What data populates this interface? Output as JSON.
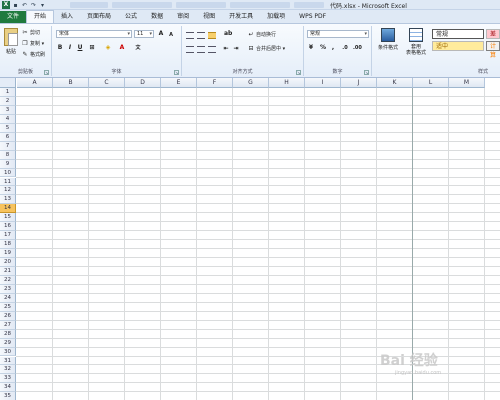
{
  "window": {
    "title": "代码.xlsx - Microsoft Excel"
  },
  "qat": {
    "app_icon": "X"
  },
  "tabs": [
    {
      "label": "文件"
    },
    {
      "label": "开始"
    },
    {
      "label": "插入"
    },
    {
      "label": "页面布局"
    },
    {
      "label": "公式"
    },
    {
      "label": "数据"
    },
    {
      "label": "审阅"
    },
    {
      "label": "视图"
    },
    {
      "label": "开发工具"
    },
    {
      "label": "加载项"
    },
    {
      "label": "WPS PDF"
    }
  ],
  "clipboard": {
    "paste": "粘贴",
    "cut": "剪切",
    "copy": "复制 ▾",
    "format_painter": "格式刷",
    "group": "剪贴板"
  },
  "font": {
    "name": "宋体",
    "size": "11",
    "grow": "A",
    "shrink": "A",
    "bold": "B",
    "italic": "I",
    "underline": "U",
    "wen": "文",
    "group": "字体"
  },
  "alignment": {
    "wrap": "自动换行",
    "merge": "合并后居中 ▾",
    "group": "对齐方式"
  },
  "number": {
    "format": "常规",
    "percent": "%",
    "comma": ",",
    "group": "数字"
  },
  "styles": {
    "conditional": "条件格式",
    "table": "套用\n表格格式",
    "normal": "常规",
    "bad": "差",
    "neutral": "适中",
    "calc": "计算",
    "group": "样式"
  },
  "columns": [
    "A",
    "B",
    "C",
    "D",
    "E",
    "F",
    "G",
    "H",
    "I",
    "J",
    "K",
    "L",
    "M"
  ],
  "rows": [
    "1",
    "2",
    "3",
    "4",
    "5",
    "6",
    "7",
    "8",
    "9",
    "10",
    "11",
    "12",
    "13",
    "14",
    "15",
    "16",
    "17",
    "18",
    "19",
    "20",
    "21",
    "22",
    "23",
    "24",
    "25",
    "26",
    "27",
    "28",
    "29",
    "30",
    "31",
    "32",
    "33",
    "34",
    "35"
  ],
  "active_row": "14",
  "watermark": {
    "main": "Bai 经验",
    "sub": "jingyan.baidu.com"
  }
}
